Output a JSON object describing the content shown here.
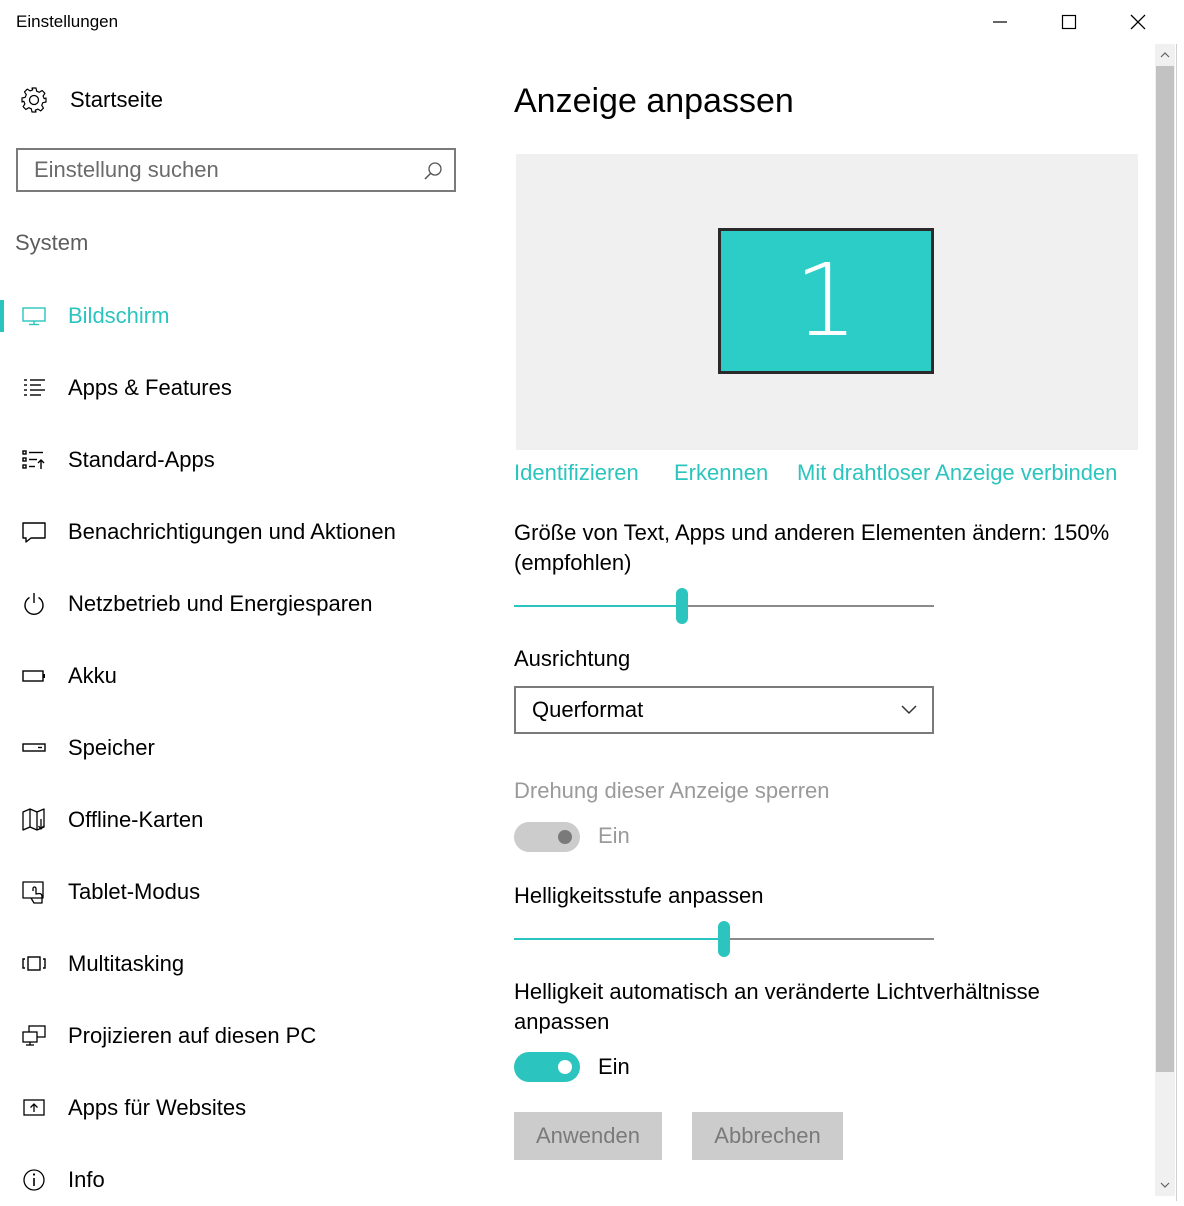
{
  "window": {
    "title": "Einstellungen",
    "controls": [
      "minimize",
      "maximize",
      "close"
    ]
  },
  "sidebar": {
    "home_label": "Startseite",
    "search_placeholder": "Einstellung suchen",
    "section_label": "System",
    "items": [
      {
        "label": "Bildschirm",
        "icon": "monitor-icon",
        "active": true
      },
      {
        "label": "Apps & Features",
        "icon": "list-icon"
      },
      {
        "label": "Standard-Apps",
        "icon": "default-apps-icon"
      },
      {
        "label": "Benachrichtigungen und Aktionen",
        "icon": "notification-icon"
      },
      {
        "label": "Netzbetrieb und Energiesparen",
        "icon": "power-icon"
      },
      {
        "label": "Akku",
        "icon": "battery-icon"
      },
      {
        "label": "Speicher",
        "icon": "storage-icon"
      },
      {
        "label": "Offline-Karten",
        "icon": "map-icon"
      },
      {
        "label": "Tablet-Modus",
        "icon": "tablet-mode-icon"
      },
      {
        "label": "Multitasking",
        "icon": "multitasking-icon"
      },
      {
        "label": "Projizieren auf diesen PC",
        "icon": "project-icon"
      },
      {
        "label": "Apps für Websites",
        "icon": "apps-websites-icon"
      },
      {
        "label": "Info",
        "icon": "info-icon"
      }
    ]
  },
  "main": {
    "title": "Anzeige anpassen",
    "display_number": "1",
    "links": {
      "identify": "Identifizieren",
      "detect": "Erkennen",
      "wireless": "Mit drahtloser Anzeige verbinden"
    },
    "scale": {
      "label_line1": "Größe von Text, Apps und anderen Elementen ändern: 150%",
      "label_line2": "(empfohlen)",
      "value_fraction": 0.4
    },
    "orientation": {
      "label": "Ausrichtung",
      "value": "Querformat"
    },
    "rotation_lock": {
      "label": "Drehung dieser Anzeige sperren",
      "state_label": "Ein",
      "enabled": false,
      "on": true
    },
    "brightness": {
      "label": "Helligkeitsstufe anpassen",
      "value_fraction": 0.5
    },
    "auto_brightness": {
      "label_line1": "Helligkeit automatisch an veränderte Lichtverhältnisse",
      "label_line2": "anpassen",
      "state_label": "Ein",
      "on": true
    },
    "buttons": {
      "apply": "Anwenden",
      "cancel": "Abbrechen"
    }
  },
  "colors": {
    "accent": "#2bc4be",
    "monitor_fill": "#2ccdc6",
    "disabled_text": "#9a9a9a",
    "button_bg": "#cccccc"
  }
}
